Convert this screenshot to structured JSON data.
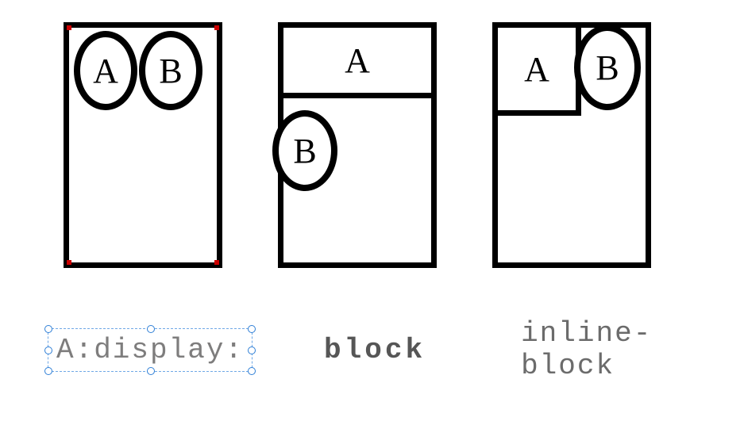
{
  "boxes": {
    "box1": {
      "a": "A",
      "b": "B"
    },
    "box2": {
      "a": "A",
      "b": "B"
    },
    "box3": {
      "a": "A",
      "b": "B"
    }
  },
  "captions": {
    "selected": "A:display:",
    "block": "block",
    "inline_block": "inline-block"
  }
}
